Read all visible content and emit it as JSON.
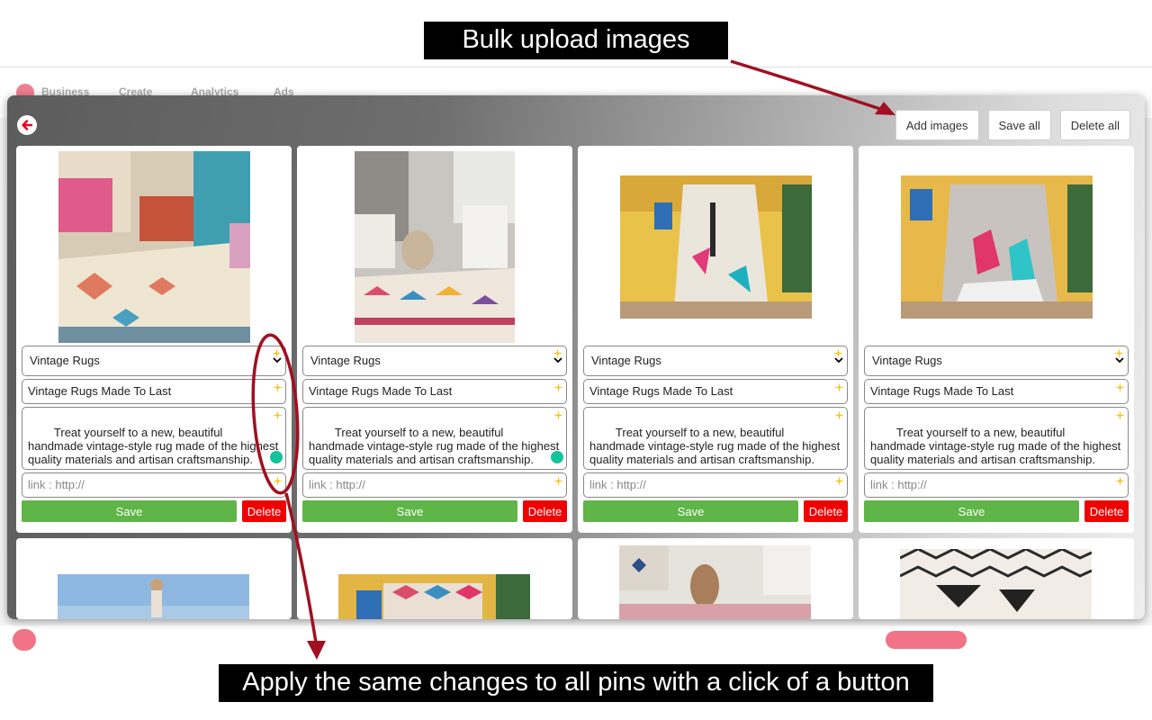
{
  "annotations": {
    "top": "Bulk upload images",
    "bottom": "Apply the same changes to all pins with a click of a button"
  },
  "background_page": {
    "nav_items": [
      "Business",
      "Create",
      "Analytics",
      "Ads"
    ],
    "colors": {
      "brand": "#e60023"
    }
  },
  "modal": {
    "actions": {
      "add_images": "Add images",
      "save_all": "Save all",
      "delete_all": "Delete all"
    },
    "cards": [
      {
        "board": "Vintage Rugs",
        "title": "Vintage Rugs Made To Last",
        "description": "Treat yourself to a new, beautiful handmade vintage-style rug made of the highest quality materials and artisan craftsmanship.",
        "link_placeholder": "link : http://",
        "save": "Save",
        "delete": "Delete"
      },
      {
        "board": "Vintage Rugs",
        "title": "Vintage Rugs Made To Last",
        "description": "Treat yourself to a new, beautiful handmade vintage-style rug made of the highest quality materials and artisan craftsmanship.",
        "link_placeholder": "link : http://",
        "save": "Save",
        "delete": "Delete"
      },
      {
        "board": "Vintage Rugs",
        "title": "Vintage Rugs Made To Last",
        "description": "Treat yourself to a new, beautiful handmade vintage-style rug made of the highest quality materials and artisan craftsmanship.",
        "link_placeholder": "link : http://",
        "save": "Save",
        "delete": "Delete"
      },
      {
        "board": "Vintage Rugs",
        "title": "Vintage Rugs Made To Last",
        "description": "Treat yourself to a new, beautiful handmade vintage-style rug made of the highest quality materials and artisan craftsmanship.",
        "link_placeholder": "link : http://",
        "save": "Save",
        "delete": "Delete"
      }
    ],
    "colors": {
      "save": "#5fb548",
      "delete": "#f00000",
      "back_icon": "#e60023",
      "annotation_arrow": "#a01020"
    }
  }
}
